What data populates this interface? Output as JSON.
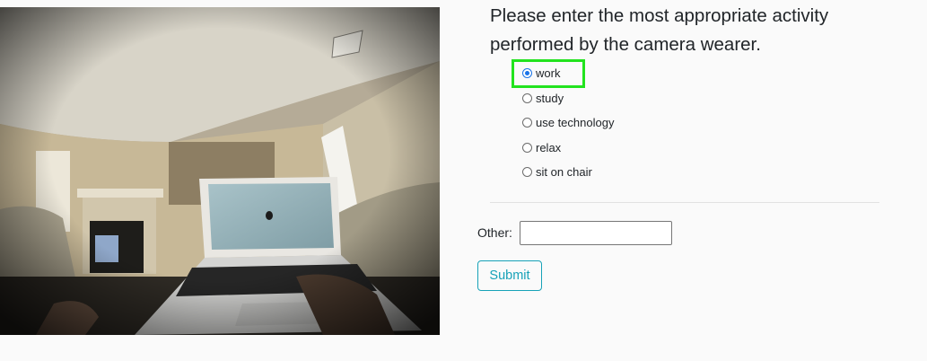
{
  "question": {
    "line1": "Please enter the most appropriate activity",
    "line2": "performed by the camera wearer."
  },
  "options": [
    {
      "label": "work",
      "checked": true
    },
    {
      "label": "study",
      "checked": false
    },
    {
      "label": "use technology",
      "checked": false
    },
    {
      "label": "relax",
      "checked": false
    },
    {
      "label": "sit on chair",
      "checked": false
    }
  ],
  "other": {
    "label": "Other:",
    "value": ""
  },
  "submit_label": "Submit",
  "colors": {
    "highlight": "#22e31e",
    "accent": "#17a2b8",
    "radio_checked": "#1a73e8"
  }
}
